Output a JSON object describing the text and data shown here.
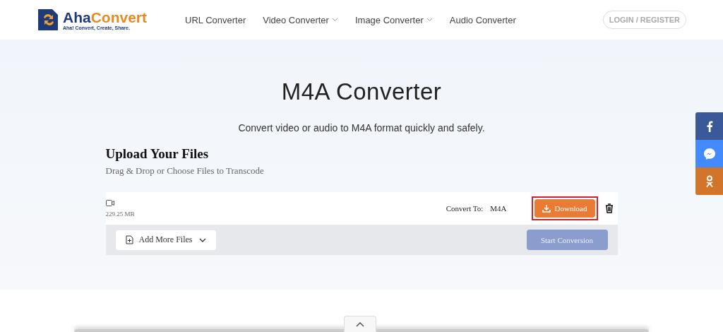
{
  "header": {
    "logo": {
      "name_part_1": "Aha",
      "name_part_2": "Convert",
      "tagline": "Aha! Convert, Create, Share."
    },
    "nav": [
      {
        "label": "URL Converter",
        "dropdown": false
      },
      {
        "label": "Video Converter",
        "dropdown": true
      },
      {
        "label": "Image Converter",
        "dropdown": true
      },
      {
        "label": "Audio Converter",
        "dropdown": false
      }
    ],
    "login": "LOGIN / REGISTER"
  },
  "hero": {
    "title": "M4A Converter",
    "subtitle": "Convert video or audio to M4A format quickly and safely."
  },
  "upload": {
    "title": "Upload Your Files",
    "hint": "Drag & Drop or Choose Files to Transcode",
    "files": [
      {
        "size": "229.25 MB",
        "convert_label": "Convert To:",
        "format": "M4A",
        "action": "Download",
        "highlighted": true
      }
    ],
    "add_more": "Add More Files",
    "start": {
      "label": "Start Conversion",
      "disabled": true
    }
  },
  "share": [
    {
      "kind": "facebook",
      "color": "#3b5998"
    },
    {
      "kind": "messenger",
      "color": "#448aff"
    },
    {
      "kind": "odnoklassniki",
      "color": "#d2752a"
    }
  ]
}
